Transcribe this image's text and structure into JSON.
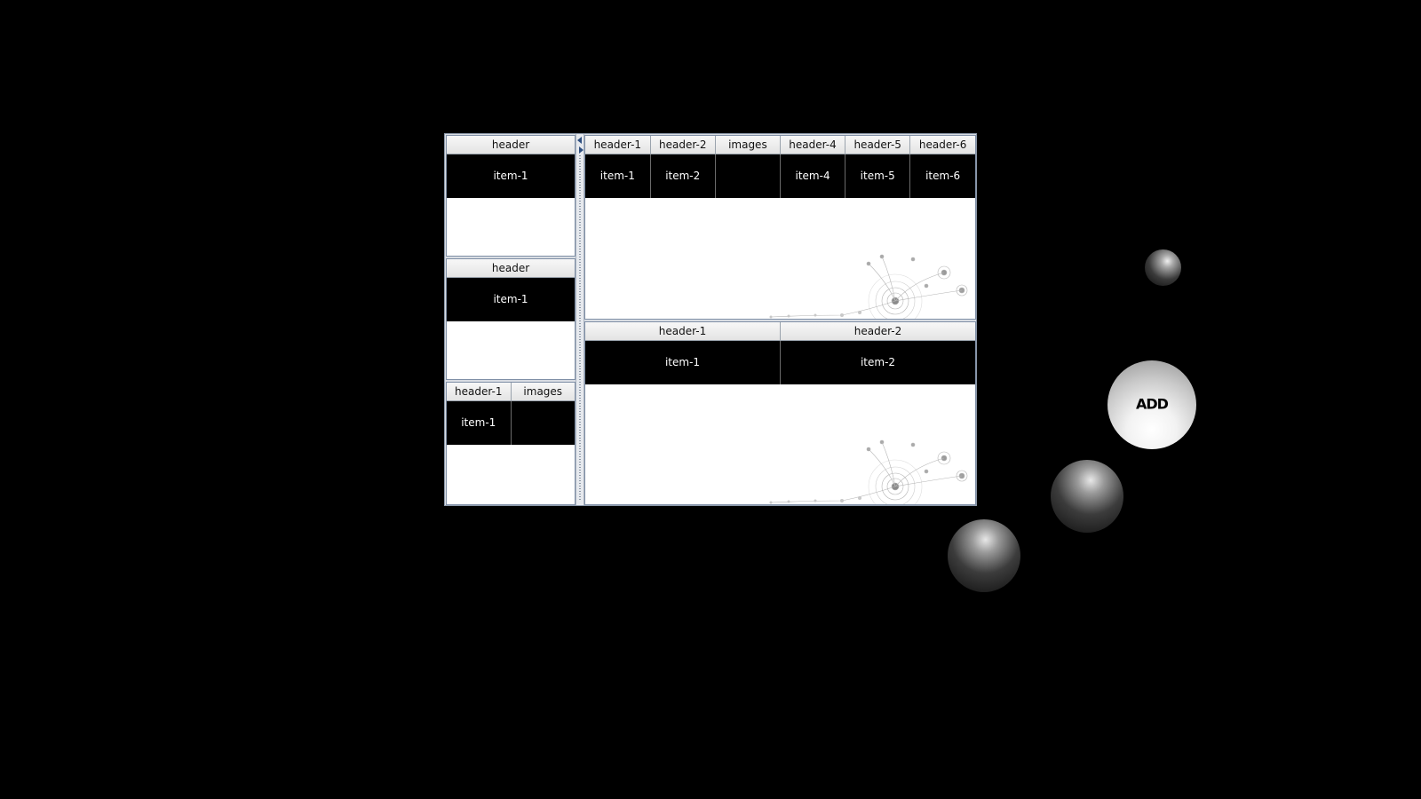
{
  "left_panels": [
    {
      "headers": [
        "header"
      ],
      "rows": [
        [
          "item-1"
        ]
      ]
    },
    {
      "headers": [
        "header"
      ],
      "rows": [
        [
          "item-1"
        ]
      ]
    },
    {
      "headers": [
        "header-1",
        "images"
      ],
      "rows": [
        [
          "item-1",
          ""
        ]
      ]
    }
  ],
  "right_panels": [
    {
      "headers": [
        "header-1",
        "header-2",
        "images",
        "header-4",
        "header-5",
        "header-6"
      ],
      "rows": [
        [
          "item-1",
          "item-2",
          "",
          "item-4",
          "item-5",
          "item-6"
        ]
      ]
    },
    {
      "headers": [
        "header-1",
        "header-2"
      ],
      "rows": [
        [
          "item-1",
          "item-2"
        ]
      ]
    }
  ],
  "add_button": {
    "label": "ADD"
  },
  "icons": {
    "split_left": "collapse-left-arrow-icon",
    "split_right": "expand-right-arrow-icon"
  },
  "colors": {
    "background": "#000000",
    "cell": "#000000",
    "header": "#e8e8e8"
  }
}
